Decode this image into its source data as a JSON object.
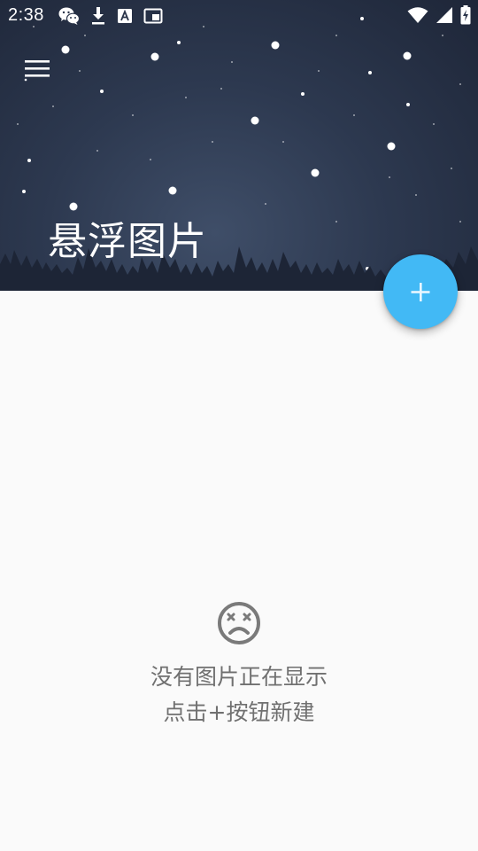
{
  "status_bar": {
    "time": "2:38",
    "left_icons": [
      "wechat-icon",
      "download-icon",
      "font-a-icon",
      "picture-in-picture-icon"
    ],
    "right_icons": [
      "wifi-icon",
      "cellular-signal-icon",
      "battery-charging-icon"
    ]
  },
  "header": {
    "title": "悬浮图片",
    "menu_icon": "hamburger-menu-icon",
    "background": "night-sky-with-stars-and-pine-trees"
  },
  "fab": {
    "icon": "plus-icon",
    "color": "#42b9f5"
  },
  "empty_state": {
    "icon": "dizzy-face-icon",
    "line1": "没有图片正在显示",
    "line2": "点击+按钮新建"
  },
  "colors": {
    "background": "#fafafa",
    "header_dark": "#1e2638",
    "text_muted": "#707070",
    "accent": "#42b9f5"
  }
}
